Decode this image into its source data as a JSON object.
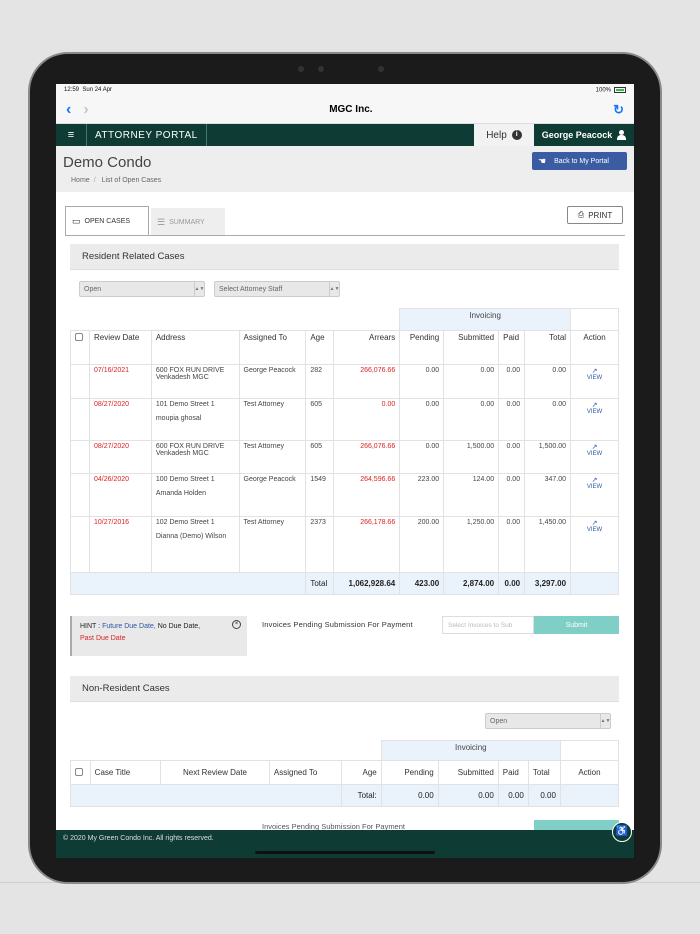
{
  "status_bar": {
    "time": "12:59",
    "date": "Sun 24 Apr",
    "battery": "100%"
  },
  "browser": {
    "title": "MGC Inc.",
    "back": "‹",
    "forward": "›",
    "reload": "↻"
  },
  "portal": {
    "menu": "≡",
    "title": "ATTORNEY PORTAL",
    "help": "Help",
    "user": "George Peacock"
  },
  "page": {
    "title": "Demo Condo",
    "breadcrumb": [
      "Home",
      "List of Open Cases"
    ],
    "back_button": "Back to My Portal"
  },
  "tabs": {
    "open": "OPEN CASES",
    "summary": "SUMMARY",
    "print": "PRINT"
  },
  "resident": {
    "section_title": "Resident Related Cases",
    "status_filter": "Open",
    "staff_filter": "Select Attorney Staff",
    "invoicing_header": "Invoicing",
    "columns": [
      "Review Date",
      "Address",
      "Assigned To",
      "Age",
      "Arrears",
      "Pending",
      "Submitted",
      "Paid",
      "Total",
      "Action"
    ],
    "rows": [
      {
        "date": "07/16/2021",
        "addr1": "600 FOX RUN DRIVE",
        "addr2": "Venkadesh MGC",
        "assigned": "George Peacock",
        "age": "282",
        "arrears": "266,076.66",
        "pending": "0.00",
        "submitted": "0.00",
        "paid": "0.00",
        "total": "0.00",
        "action": "VIEW"
      },
      {
        "date": "08/27/2020",
        "addr1": "101 Demo Street 1",
        "addr2": "moupia ghosal",
        "assigned": "Test Attorney",
        "age": "605",
        "arrears": "0.00",
        "pending": "0.00",
        "submitted": "0.00",
        "paid": "0.00",
        "total": "0.00",
        "action": "VIEW"
      },
      {
        "date": "08/27/2020",
        "addr1": "600 FOX RUN DRIVE",
        "addr2": "Venkadesh MGC",
        "assigned": "Test Attorney",
        "age": "605",
        "arrears": "266,076.66",
        "pending": "0.00",
        "submitted": "1,500.00",
        "paid": "0.00",
        "total": "1,500.00",
        "action": "VIEW"
      },
      {
        "date": "04/26/2020",
        "addr1": "100 Demo Street 1",
        "addr2": "Amanda Holden",
        "assigned": "George Peacock",
        "age": "1549",
        "arrears": "264,596.66",
        "pending": "223.00",
        "submitted": "124.00",
        "paid": "0.00",
        "total": "347.00",
        "action": "VIEW"
      },
      {
        "date": "10/27/2016",
        "addr1": "102 Demo Street 1",
        "addr2": "Dianna (Demo) Wilson",
        "assigned": "Test Attorney",
        "age": "2373",
        "arrears": "266,178.66",
        "pending": "200.00",
        "submitted": "1,250.00",
        "paid": "0.00",
        "total": "1,450.00",
        "action": "VIEW"
      }
    ],
    "totals": {
      "label": "Total",
      "arrears": "1,062,928.64",
      "pending": "423.00",
      "submitted": "2,874.00",
      "paid": "0.00",
      "total": "3,297.00"
    }
  },
  "hint": {
    "prefix": "HINT :",
    "future": "Future Due Date,",
    "none": "No Due Date,",
    "past": "Past Due Date",
    "close": "×"
  },
  "pending_submission": {
    "label": "Invoices Pending Submission For Payment",
    "placeholder": "Select Invoices to Sub",
    "submit": "Submit"
  },
  "non_resident": {
    "section_title": "Non-Resident Cases",
    "status_filter": "Open",
    "invoicing_header": "Invoicing",
    "columns": [
      "Case Title",
      "Next Review Date",
      "Assigned To",
      "Age",
      "Pending",
      "Submitted",
      "Paid",
      "Total",
      "Action"
    ],
    "totals": {
      "label": "Total:",
      "pending": "0.00",
      "submitted": "0.00",
      "paid": "0.00",
      "total": "0.00"
    }
  },
  "footer": {
    "copyright": "© 2020 My Green Condo Inc. All rights reserved."
  },
  "colors": {
    "portal_green": "#0e3b33",
    "link_blue": "#2a57a6",
    "due_red": "#d22222",
    "submit_teal": "#7fcfc6",
    "back_button_blue": "#3b5ca3"
  }
}
